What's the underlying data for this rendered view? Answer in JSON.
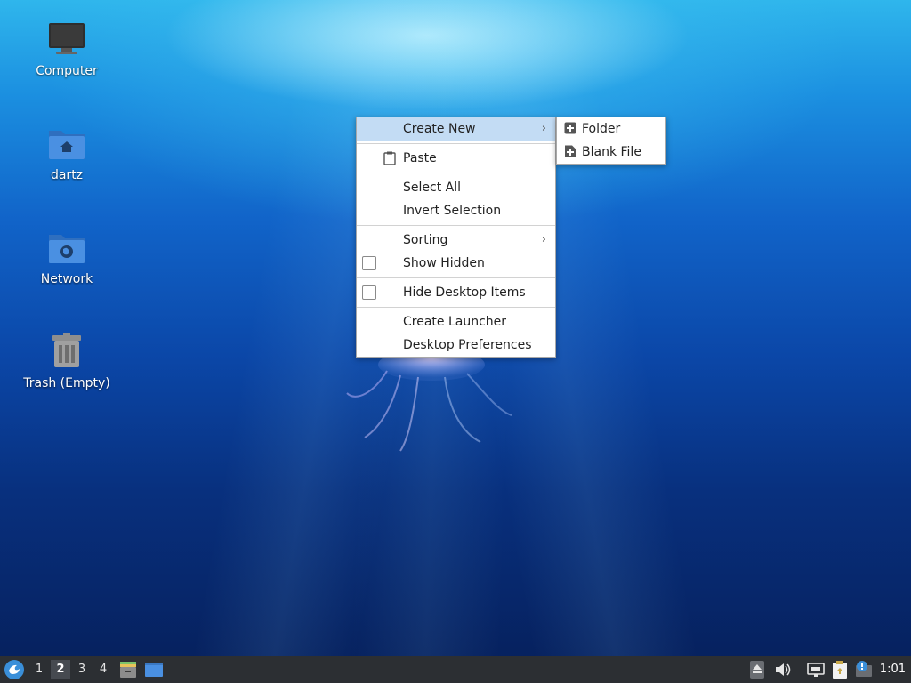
{
  "desktop": {
    "icons": [
      {
        "name": "computer",
        "label": "Computer"
      },
      {
        "name": "home",
        "label": "dartz"
      },
      {
        "name": "network",
        "label": "Network"
      },
      {
        "name": "trash",
        "label": "Trash (Empty)"
      }
    ]
  },
  "context_menu": {
    "create_new": "Create New",
    "paste": "Paste",
    "select_all": "Select All",
    "invert_selection": "Invert Selection",
    "sorting": "Sorting",
    "show_hidden": "Show Hidden",
    "hide_desktop_items": "Hide Desktop Items",
    "create_launcher": "Create Launcher",
    "desktop_preferences": "Desktop Preferences",
    "arrow_glyph": "›"
  },
  "submenu": {
    "folder": "Folder",
    "blank_file": "Blank File"
  },
  "panel": {
    "workspaces": [
      "1",
      "2",
      "3",
      "4"
    ],
    "active_workspace": "2",
    "clock": "1:01"
  },
  "colors": {
    "menu_highlight": "#c3dcf4",
    "panel_bg": "#2c2f33",
    "folder_blue": "#3f86d6"
  }
}
